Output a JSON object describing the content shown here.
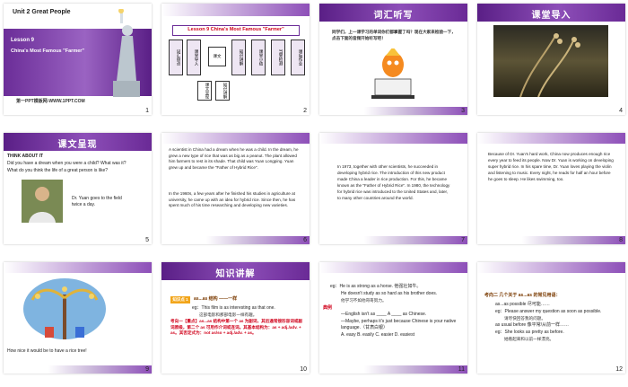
{
  "slides": [
    {
      "num": "1",
      "unit": "Unit 2   Great People",
      "lesson": "Lesson 9",
      "subtitle": "China's Most Famous \"Farmer\"",
      "footer": "第一PPT模板网-WWW.1PPT.COM"
    },
    {
      "num": "2",
      "title": "Lesson 9 China's Most Famous \"Farmer\"",
      "boxes": [
        "词汇盘点",
        "课堂导入",
        "课文",
        "知识讲解",
        "课堂小结",
        "当堂检测",
        "课后作业"
      ],
      "subboxes": [
        "课文呈现",
        "知识讲解"
      ]
    },
    {
      "num": "3",
      "header": "词汇听写",
      "text": "同学们，上一课学习的单词你们都掌握了吗？现在大家来检验一下，点击下面的音频开始听写吧！"
    },
    {
      "num": "4",
      "header": "课堂导入"
    },
    {
      "num": "5",
      "header": "课文呈现",
      "think": "THINK ABOUT IT",
      "q1": "Did you have a dream when you were a child? What was it?",
      "q2": "What do you think the life of a great person is like?",
      "caption": "Dr. Yuan goes to the field twice a day."
    },
    {
      "num": "6",
      "p1": "A scientist in China had a dream when he was a child. In the dream, he grew a new type of rice that was as big as a peanut. The plant allowed him farmers to rest in its shade. That child was Yuan Longping. Yuan grew up and became the \"Father of Hybrid Rice\".",
      "p2": "In the 1960s, a few years after he finished his studies in agriculture at university, he came up with an idea for hybrid rice. Since then, he has spent much of his time researching and developing new varieties."
    },
    {
      "num": "7",
      "p1": "In 1973, together with other scientists, he succeeded in developing hybrid rice. The introduction of this new product made China a leader in rice production. For this, he became known as the \"Father of Hybrid Rice\". In 1980, the technology for hybrid rice was introduced to the United States and, later, to many other countries around the world."
    },
    {
      "num": "8",
      "p1": "Because of Dr. Yuan's hard work, China now produces enough rice every year to feed its people. Now Dr. Yuan is working on developing super hybrid rice. In his spare time, Dr. Yuan loves playing the violin and listening to music. Every night, he reads for half an hour before he goes to sleep. He likes swimming, too."
    },
    {
      "num": "9",
      "caption": "How nice it would be to have a rice tree!"
    },
    {
      "num": "10",
      "header": "知识讲解",
      "tag": "知识点 1",
      "point": "as...as 结构 ——一样",
      "eg": "eg：This film is as interesting as that one.",
      "egcn": "这部电影和那部电影一样有趣。",
      "note": "考向一【重点】as...as 结构中第一个 as 为副词，其后通常接形容词或副词原级，第二个 as 可用作介词或连词。其基本结构为：as + adj./adv. + as。其否定式为：not as/so + adj./adv. + as。"
    },
    {
      "num": "11",
      "eg1": "eg：He is as strong as a horse. 他强壮如牛。",
      "eg2": "He doesn't study as so hard as his brother does.",
      "eg2cn": "他学习不如他哥哥努力。",
      "dian": "典例",
      "ex1": "—English isn't as ____ A ____ as Chinese.",
      "ex2": "—Maybe, perhaps it's just because Chinese is your native language.（甘肃白银）",
      "opts": "A. easy   B. easily   C. easier   D. easiest"
    },
    {
      "num": "12",
      "note": "考向二 几个关于 as...as 的常见用语：",
      "l1": "as...as possible 尽可能……",
      "l2": "eg：Please answer my question as soon as possible.",
      "l2cn": "请尽快回答我的问题。",
      "l3": "as usual before 像平常/从前一样……",
      "l4": "eg：She looks as pretty as before.",
      "l4cn": "她看起来和以前一样漂亮。"
    }
  ]
}
